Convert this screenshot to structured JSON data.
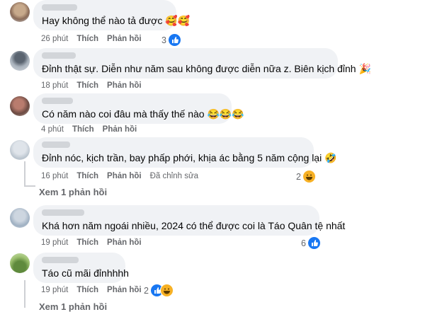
{
  "comments": [
    {
      "text": "Hay không thể nào tả được 🥰🥰",
      "time": "26 phút",
      "like": "Thích",
      "reply": "Phản hồi",
      "edited": "",
      "reaction_count": "3",
      "reactions": [
        "like"
      ]
    },
    {
      "text": "Đỉnh thật sự. Diễn như năm sau không được diễn nữa z. Biên kịch đỉnh 🎉",
      "time": "18 phút",
      "like": "Thích",
      "reply": "Phản hồi",
      "edited": "",
      "reaction_count": "",
      "reactions": []
    },
    {
      "text": "Có năm nào coi đâu mà thấy thế nào 😂😂😂",
      "time": "4 phút",
      "like": "Thích",
      "reply": "Phản hồi",
      "edited": "",
      "reaction_count": "",
      "reactions": []
    },
    {
      "text": "Đỉnh nóc, kịch trần, bay phấp phới, khịa ác bằng 5 năm cộng lại 🤣",
      "time": "16 phút",
      "like": "Thích",
      "reply": "Phản hồi",
      "edited": "Đã chỉnh sửa",
      "reaction_count": "2",
      "reactions": [
        "haha"
      ]
    },
    {
      "text": "Khá hơn năm ngoái nhiều, 2024 có thể được coi là Táo Quân tệ nhất",
      "time": "19 phút",
      "like": "Thích",
      "reply": "Phản hồi",
      "edited": "",
      "reaction_count": "6",
      "reactions": [
        "like"
      ]
    },
    {
      "text": "Táo cũ mãi đỉnhhhh",
      "time": "19 phút",
      "like": "Thích",
      "reply": "Phản hồi",
      "edited": "",
      "reaction_count": "2",
      "reactions": [
        "like",
        "haha"
      ]
    }
  ],
  "view_replies": [
    "Xem 1 phản hồi",
    "Xem 1 phản hồi"
  ],
  "colors": {
    "like": "#1877f2",
    "haha": "#f7b125",
    "bubble": "#f0f2f5",
    "meta": "#65676b"
  }
}
